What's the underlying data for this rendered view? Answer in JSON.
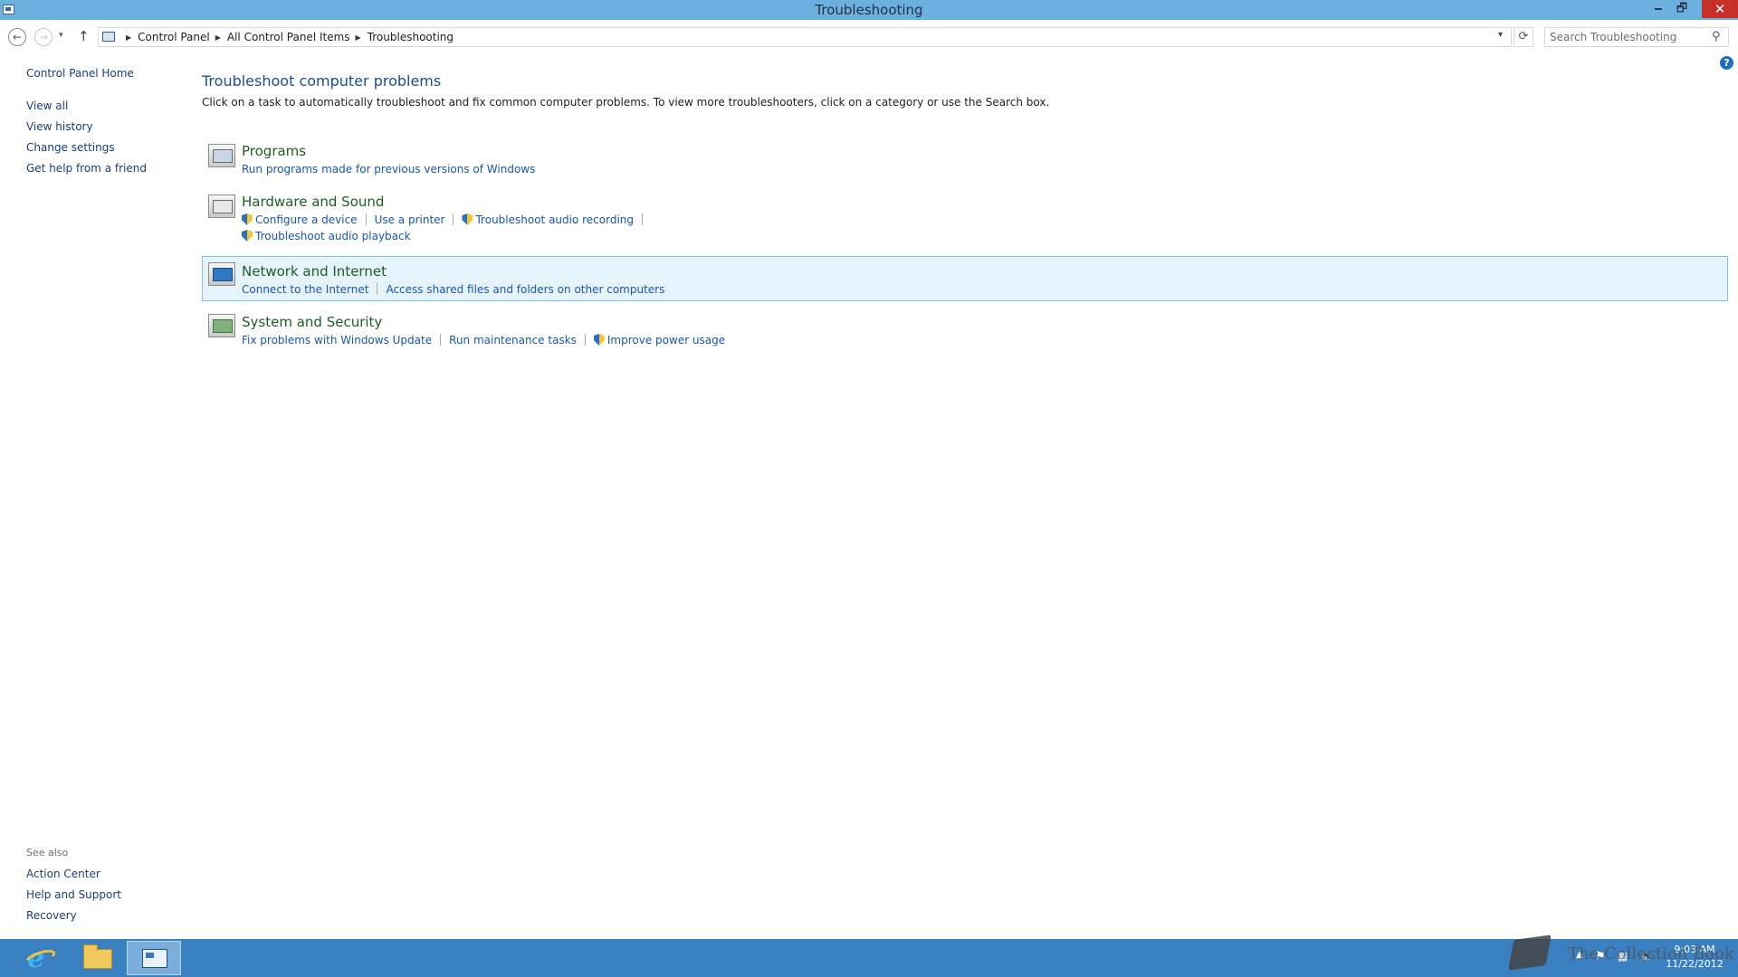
{
  "window": {
    "title": "Troubleshooting",
    "minimize": "🗕",
    "restore": "🗗",
    "close": "✕"
  },
  "navigation": {
    "back": "←",
    "forward": "→",
    "recent": "▾",
    "up": "↑",
    "breadcrumbs": [
      "Control Panel",
      "All Control Panel Items",
      "Troubleshooting"
    ],
    "breadcrumb_sep": "▶",
    "dropdown": "▾",
    "refresh": "⟳",
    "search_placeholder": "Search Troubleshooting",
    "search_glyph": "⚲"
  },
  "left_pane": {
    "home": "Control Panel Home",
    "links": [
      "View all",
      "View history",
      "Change settings",
      "Get help from a friend"
    ],
    "see_also_heading": "See also",
    "see_also": [
      "Action Center",
      "Help and Support",
      "Recovery"
    ]
  },
  "help_glyph": "?",
  "main": {
    "title": "Troubleshoot computer problems",
    "description": "Click on a task to automatically troubleshoot and fix common computer problems. To view more troubleshooters, click on a category or use the Search box.",
    "categories": [
      {
        "title": "Programs",
        "icon": "programs-icon",
        "tasks": [
          {
            "label": "Run programs made for previous versions of Windows",
            "shield": false
          }
        ]
      },
      {
        "title": "Hardware and Sound",
        "icon": "hardware-sound-icon",
        "tasks": [
          {
            "label": "Configure a device",
            "shield": true
          },
          {
            "label": "Use a printer",
            "shield": false
          },
          {
            "label": "Troubleshoot audio recording",
            "shield": true
          },
          {
            "label": "Troubleshoot audio playback",
            "shield": true
          }
        ]
      },
      {
        "title": "Network and Internet",
        "icon": "network-internet-icon",
        "tasks": [
          {
            "label": "Connect to the Internet",
            "shield": false
          },
          {
            "label": "Access shared files and folders on other computers",
            "shield": false
          }
        ]
      },
      {
        "title": "System and Security",
        "icon": "system-security-icon",
        "tasks": [
          {
            "label": "Fix problems with Windows Update",
            "shield": false
          },
          {
            "label": "Run maintenance tasks",
            "shield": false
          },
          {
            "label": "Improve power usage",
            "shield": true
          }
        ]
      }
    ]
  },
  "taskbar": {
    "apps": [
      "internet-explorer-icon",
      "file-explorer-icon",
      "control-panel-icon"
    ],
    "tray": {
      "arrow": "▲",
      "flag": "⚑",
      "network": "▦",
      "volume": "🔈"
    },
    "time": "9:03 AM",
    "date": "11/22/2012"
  },
  "watermark_text": "The Collection Book",
  "colors": {
    "titlebar": "#6cb0e0",
    "taskbar": "#3a7fc0",
    "link": "#1a57a8",
    "category_title": "#1e5e22",
    "hover_bg": "#e5f3fb",
    "close_button": "#c7302a"
  }
}
